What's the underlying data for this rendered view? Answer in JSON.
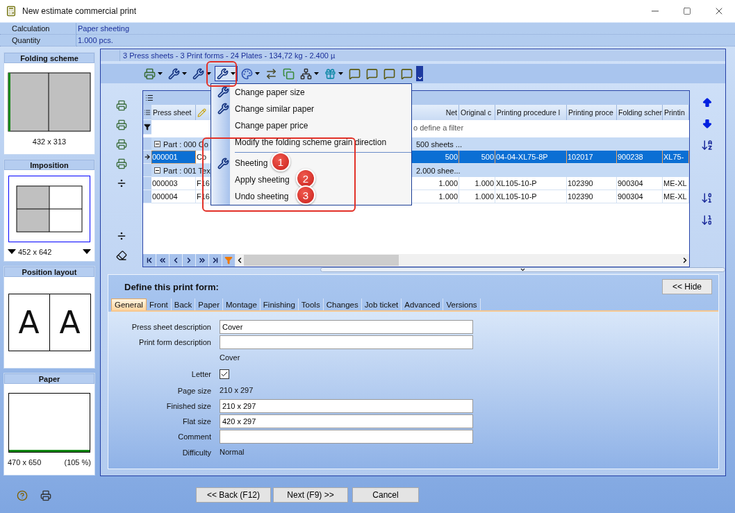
{
  "window": {
    "title": "New estimate commercial print"
  },
  "info": [
    {
      "label": "Calculation",
      "value": "Paper sheeting"
    },
    {
      "label": "Quantity",
      "value": "1.000 pcs."
    }
  ],
  "panels": [
    {
      "kind": "folding",
      "title": "Folding scheme",
      "captions": [
        "432 x 313"
      ]
    },
    {
      "kind": "imposition",
      "title": "Imposition",
      "captions": [
        "452 x 642"
      ]
    },
    {
      "kind": "layout",
      "title": "Position layout",
      "letters": [
        "A",
        "A"
      ]
    },
    {
      "kind": "paper",
      "title": "Paper",
      "captions": [
        "470 x 650",
        "(105 %)"
      ]
    }
  ],
  "summary": "3 Press sheets - 3 Print forms - 24 Plates - 134,72 kg - 2.400 µ",
  "toolbar": [
    {
      "kind": "printer",
      "dropdown": true,
      "pressed": false
    },
    {
      "kind": "wrench",
      "dropdown": true,
      "pressed": false
    },
    {
      "kind": "wrench",
      "dropdown": true,
      "pressed": false
    },
    {
      "kind": "wrench",
      "dropdown": true,
      "pressed": true
    },
    {
      "kind": "palette",
      "dropdown": true,
      "pressed": false
    },
    {
      "kind": "arrange",
      "dropdown": false,
      "pressed": false
    },
    {
      "kind": "copy",
      "dropdown": false,
      "pressed": false
    },
    {
      "kind": "tree",
      "dropdown": true,
      "pressed": false
    },
    {
      "kind": "gift",
      "dropdown": true,
      "pressed": false
    },
    {
      "kind": "note",
      "dropdown": false,
      "pressed": false
    },
    {
      "kind": "note",
      "dropdown": false,
      "pressed": false
    },
    {
      "kind": "note",
      "dropdown": false,
      "pressed": false
    },
    {
      "kind": "note",
      "dropdown": false,
      "pressed": false
    }
  ],
  "menu": {
    "sections": [
      {
        "items": [
          {
            "label": "Change paper size",
            "icon": true
          },
          {
            "label": "Change similar paper",
            "icon": true
          },
          {
            "label": "Change paper price",
            "icon": false
          },
          {
            "label": "Modify the folding scheme grain direction",
            "icon": false
          }
        ]
      },
      {
        "items": [
          {
            "label": "Sheeting",
            "icon": true
          },
          {
            "label": "Apply sheeting",
            "icon": false
          },
          {
            "label": "Undo sheeting",
            "icon": false
          }
        ]
      }
    ]
  },
  "annotations": [
    {
      "label": "1"
    },
    {
      "label": "2"
    },
    {
      "label": "3"
    }
  ],
  "grid": {
    "columns": [
      {
        "kind": "text",
        "label": "Press sheet"
      },
      {
        "kind": "pencil"
      },
      {
        "kind": "text",
        "label": "Net"
      },
      {
        "kind": "text",
        "label": "Original c"
      },
      {
        "kind": "text",
        "label": "Printing procedure l"
      },
      {
        "kind": "text",
        "label": "Printing proce"
      },
      {
        "kind": "text",
        "label": "Folding scher"
      },
      {
        "kind": "text",
        "label": "Printin"
      }
    ],
    "filter_hint": "o define a filter",
    "rows": [
      {
        "kind": "group",
        "expanded": true,
        "label": "Part : 000 Co",
        "summary": "500 sheets ..."
      },
      {
        "kind": "row",
        "selected": true,
        "cells": [
          "000001",
          "Co",
          "500",
          "500",
          "04-04-XL75-8P",
          "102017",
          "900238",
          "XL75-"
        ]
      },
      {
        "kind": "group",
        "expanded": true,
        "label": "Part : 001 Tex",
        "summary": "2.000 shee..."
      },
      {
        "kind": "row",
        "selected": false,
        "cells": [
          "000003",
          "F16",
          "1.000",
          "1.000",
          "XL105-10-P",
          "102390",
          "900304",
          "ME-XL"
        ]
      },
      {
        "kind": "row",
        "selected": false,
        "cells": [
          "000004",
          "F16",
          "1.000",
          "1.000",
          "XL105-10-P",
          "102390",
          "900304",
          "ME-XL"
        ]
      }
    ]
  },
  "detail": {
    "title": "Define this print form:",
    "hide_button": "<< Hide",
    "tabs": [
      {
        "label": "General",
        "selected": true
      },
      {
        "label": "Front",
        "selected": false
      },
      {
        "label": "Back",
        "selected": false
      },
      {
        "label": "Paper",
        "selected": false
      },
      {
        "label": "Montage",
        "selected": false
      },
      {
        "label": "Finishing",
        "selected": false
      },
      {
        "label": "Tools",
        "selected": false
      },
      {
        "label": "Changes",
        "selected": false
      },
      {
        "label": "Job ticket",
        "selected": false
      },
      {
        "label": "Advanced",
        "selected": false
      },
      {
        "label": "Versions",
        "selected": false
      }
    ],
    "fields": [
      {
        "kind": "input",
        "label": "Press sheet description",
        "value": "Cover"
      },
      {
        "kind": "input",
        "label": "Print form description"
      },
      {
        "kind": "text",
        "value": "Cover"
      },
      {
        "kind": "checkbox",
        "label": "Letter",
        "checked": true
      },
      {
        "kind": "text",
        "label": "Page size",
        "value": "210 x 297"
      },
      {
        "kind": "input",
        "label": "Finished size",
        "value": "210 x 297"
      },
      {
        "kind": "input",
        "label": "Flat size",
        "value": "420 x 297"
      },
      {
        "kind": "input",
        "label": "Comment"
      },
      {
        "kind": "text",
        "label": "Difficulty",
        "value": "Normal"
      }
    ]
  },
  "buttons": [
    "<< Back (F12)",
    "Next (F9) >>",
    "Cancel"
  ]
}
